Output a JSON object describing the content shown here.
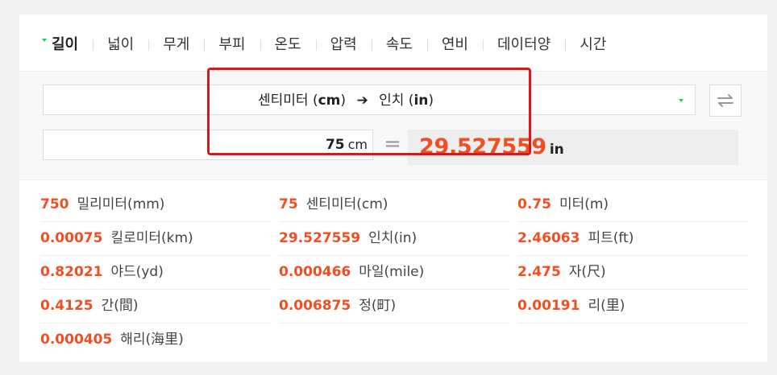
{
  "tabs": [
    {
      "label": "길이",
      "active": true
    },
    {
      "label": "넓이"
    },
    {
      "label": "무게"
    },
    {
      "label": "부피"
    },
    {
      "label": "온도"
    },
    {
      "label": "압력"
    },
    {
      "label": "속도"
    },
    {
      "label": "연비"
    },
    {
      "label": "데이터양"
    },
    {
      "label": "시간"
    }
  ],
  "converter": {
    "from_unit_name": "센티미터",
    "from_unit_symbol": "cm",
    "to_unit_name": "인치",
    "to_unit_symbol": "in",
    "input_value": "75",
    "input_unit": "cm",
    "equals": "=",
    "result_value": "29.527559",
    "result_unit": "in"
  },
  "results": [
    {
      "value": "750",
      "unit": "밀리미터(mm)"
    },
    {
      "value": "75",
      "unit": "센티미터(cm)"
    },
    {
      "value": "0.75",
      "unit": "미터(m)"
    },
    {
      "value": "0.00075",
      "unit": "킬로미터(km)"
    },
    {
      "value": "29.527559",
      "unit": "인치(in)"
    },
    {
      "value": "2.46063",
      "unit": "피트(ft)"
    },
    {
      "value": "0.82021",
      "unit": "야드(yd)"
    },
    {
      "value": "0.000466",
      "unit": "마일(mile)"
    },
    {
      "value": "2.475",
      "unit": "자(尺)"
    },
    {
      "value": "0.4125",
      "unit": "간(間)"
    },
    {
      "value": "0.006875",
      "unit": "정(町)"
    },
    {
      "value": "0.00191",
      "unit": "리(里)"
    },
    {
      "value": "0.000405",
      "unit": "해리(海里)"
    }
  ],
  "colors": {
    "accent": "#f04e23",
    "highlight_frame": "#d9181c",
    "caret": "#19ce60"
  },
  "icons": {
    "swap": "swap-arrows-icon",
    "arrow": "arrow-right-icon",
    "caret": "chevron-down-icon"
  }
}
